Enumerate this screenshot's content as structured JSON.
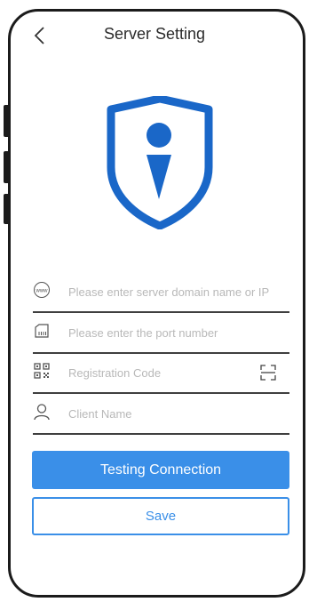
{
  "header": {
    "title": "Server Setting"
  },
  "form": {
    "server": {
      "placeholder": "Please enter server domain name or IP",
      "icon": "www-globe-icon"
    },
    "port": {
      "placeholder": "Please enter the port number",
      "icon": "port-icon"
    },
    "registration": {
      "placeholder": "Registration Code",
      "icon": "qr-code-icon"
    },
    "client": {
      "placeholder": "Client Name",
      "icon": "user-icon"
    }
  },
  "buttons": {
    "test_label": "Testing Connection",
    "save_label": "Save"
  },
  "colors": {
    "accent": "#3a8fe8",
    "shield": "#1a67c8"
  }
}
